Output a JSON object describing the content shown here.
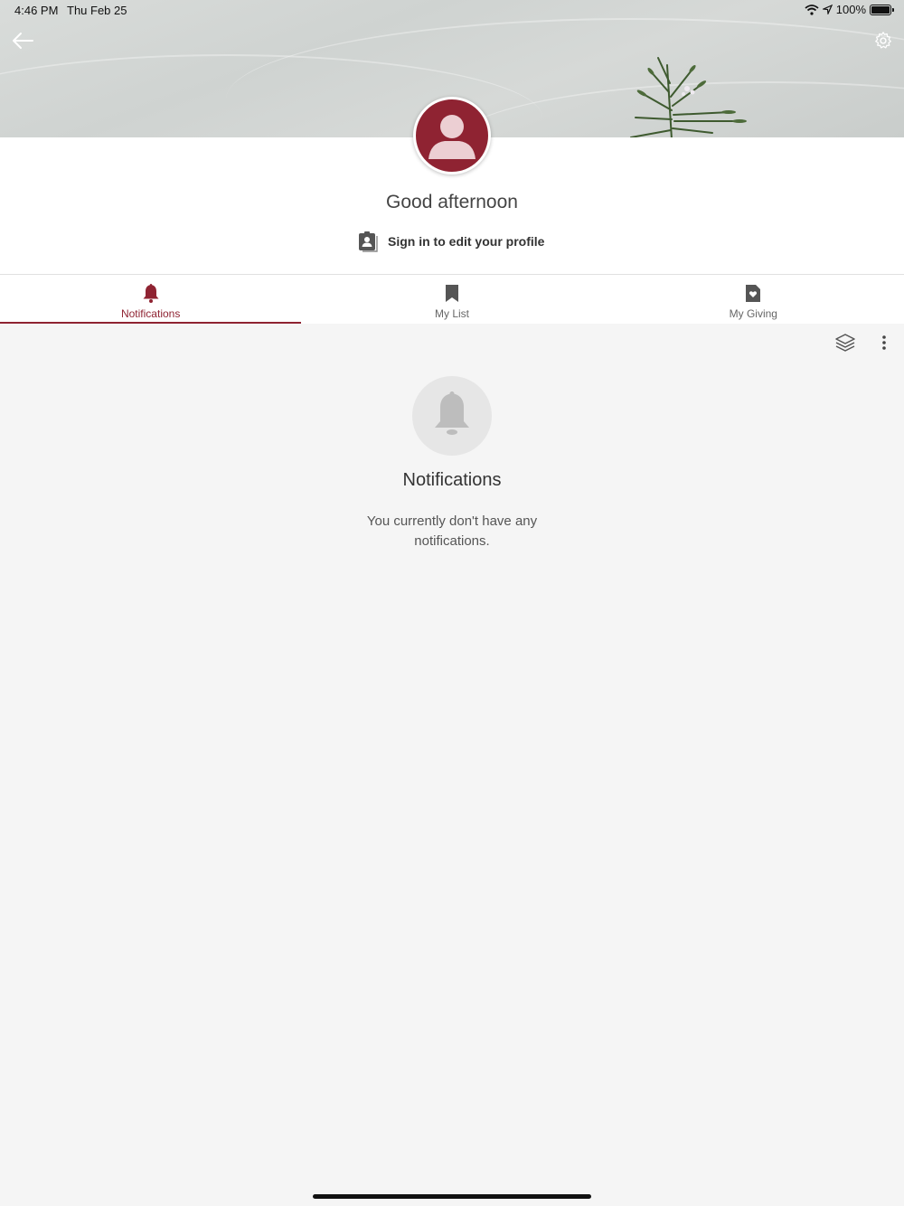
{
  "status_bar": {
    "time": "4:46 PM",
    "date": "Thu Feb 25",
    "battery": "100%",
    "battery_level": 1.0
  },
  "header": {
    "back_icon": "arrow-left-icon",
    "settings_icon": "gear-icon",
    "greeting": "Good afternoon",
    "signin_label": "Sign in to edit your profile"
  },
  "tabs": [
    {
      "label": "Notifications",
      "icon": "bell-icon",
      "active": true
    },
    {
      "label": "My List",
      "icon": "bookmark-icon",
      "active": false
    },
    {
      "label": "My Giving",
      "icon": "heart-document-icon",
      "active": false
    }
  ],
  "toolbar": {
    "layers_icon": "layers-icon",
    "more_icon": "more-vertical-icon"
  },
  "empty_state": {
    "title": "Notifications",
    "message": "You currently don't have any notifications."
  },
  "colors": {
    "accent": "#8f2332",
    "background": "#f5f5f5"
  }
}
